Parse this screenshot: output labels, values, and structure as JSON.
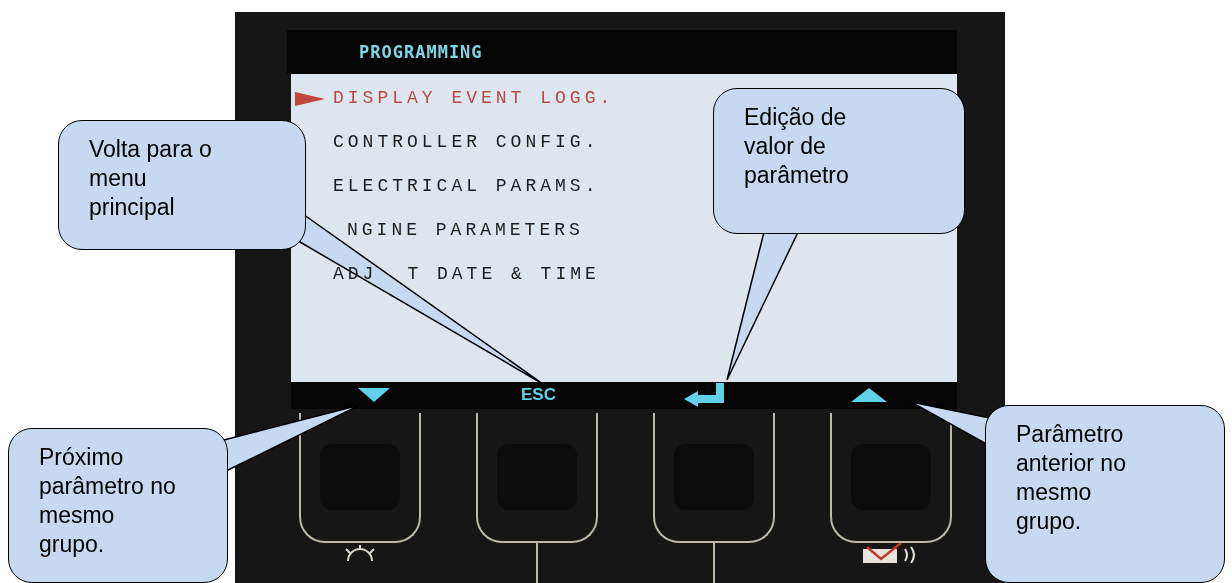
{
  "screen": {
    "title": "PROGRAMMING",
    "items": [
      {
        "kind": "plain",
        "selected": true,
        "segments": [
          "DISPLAY EVENT LOGG."
        ]
      },
      {
        "kind": "plain",
        "selected": false,
        "segments": [
          "CONTROLLER CONFIG."
        ]
      },
      {
        "kind": "plain",
        "selected": false,
        "segments": [
          "ELECTRICAL PARAMS."
        ]
      },
      {
        "kind": "covered-start",
        "selected": false,
        "segments": [
          "NGINE PARAMETERS"
        ]
      },
      {
        "kind": "plain",
        "selected": false,
        "segments": [
          "ADJ",
          "T DATE & TIME"
        ]
      }
    ],
    "softkeys": [
      {
        "kind": "down"
      },
      {
        "kind": "text",
        "label": "ESC"
      },
      {
        "kind": "enter"
      },
      {
        "kind": "up"
      }
    ]
  },
  "callouts": [
    {
      "text": "Volta para o\nmenu\nprincipal"
    },
    {
      "text": "Edição de\nvalor de\nparâmetro"
    },
    {
      "text": "Próximo\nparâmetro no\nmesmo\ngrupo."
    },
    {
      "text": "Parâmetro\nanterior no\nmesmo\ngrupo."
    }
  ]
}
